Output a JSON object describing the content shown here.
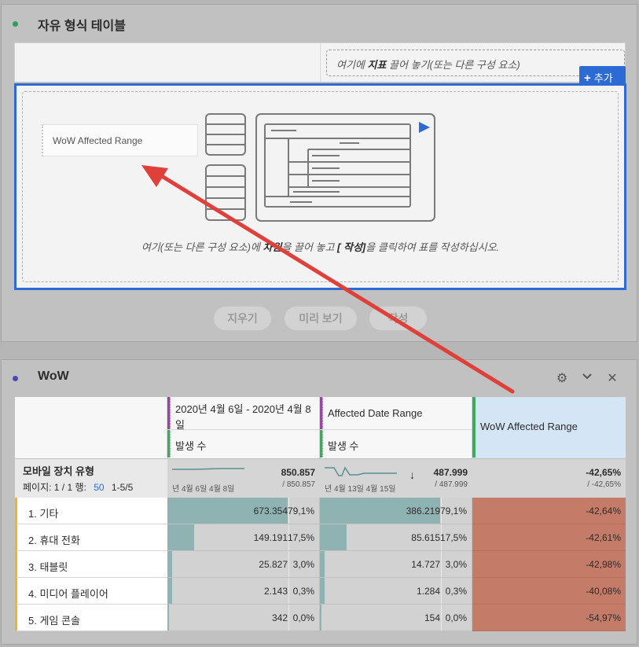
{
  "panel1": {
    "title": "자유 형식 테이블",
    "drop_metric_prefix": "여기에 ",
    "drop_metric_bold": "지표",
    "drop_metric_suffix": " 끌어 놓기(또는 다른 구성 요소)",
    "add_button": "추가",
    "dimension_chip": "WoW Affected Range",
    "hint_prefix": "여기(또는 다른 구성 요소)에 ",
    "hint_bold1": "차원",
    "hint_middle": "을 끌어 놓고 ",
    "hint_bold2": "[ 작성]",
    "hint_suffix": "을 클릭하여 표를 작성하십시오.",
    "buttons": {
      "clear": "지우기",
      "preview": "미리 보기",
      "build": "작성"
    }
  },
  "panel2": {
    "title": "WoW",
    "columns": [
      {
        "title": "2020년 4월 6일 - 2020년 4월 8일",
        "metric": "발생 수",
        "total": "850.857",
        "total_sub": "/ 850.857",
        "sparkline_dates": "년 4월 6일 4월 8일"
      },
      {
        "title": "Affected Date Range",
        "metric": "발생 수",
        "total": "487.999",
        "total_sub": "/ 487.999",
        "sparkline_dates": "년 4월 13일 4월 15일",
        "sort": "↓"
      },
      {
        "title": "WoW Affected Range",
        "total": "-42,65%",
        "total_sub": "/ -42,65%"
      }
    ],
    "dimension_header": "모바일 장치 유형",
    "page_info": {
      "label": "페이지: 1 / 1 행:",
      "rows": "50",
      "range": "1-5/5"
    },
    "rows": [
      {
        "label": "1. 기타",
        "c1": "673.354",
        "p1": "79,1%",
        "c2": "386.219",
        "p2": "79,1%",
        "wow": "-42,64%"
      },
      {
        "label": "2. 휴대 전화",
        "c1": "149.191",
        "p1": "17,5%",
        "c2": "85.615",
        "p2": "17,5%",
        "wow": "-42,61%"
      },
      {
        "label": "3. 태블릿",
        "c1": "25.827",
        "p1": "3,0%",
        "c2": "14.727",
        "p2": "3,0%",
        "wow": "-42,98%"
      },
      {
        "label": "4. 미디어 플레이어",
        "c1": "2.143",
        "p1": "0,3%",
        "c2": "1.284",
        "p2": "0,3%",
        "wow": "-40,08%"
      },
      {
        "label": "5. 게임 콘솔",
        "c1": "342",
        "p1": "0,0%",
        "c2": "154",
        "p2": "0,0%",
        "wow": "-54,97%"
      }
    ]
  },
  "colors": {
    "accent": "#2d6bd4",
    "arrow": "#e0403a",
    "wow_fill": "#c47b67",
    "bar_fill": "#8fb3b3"
  }
}
